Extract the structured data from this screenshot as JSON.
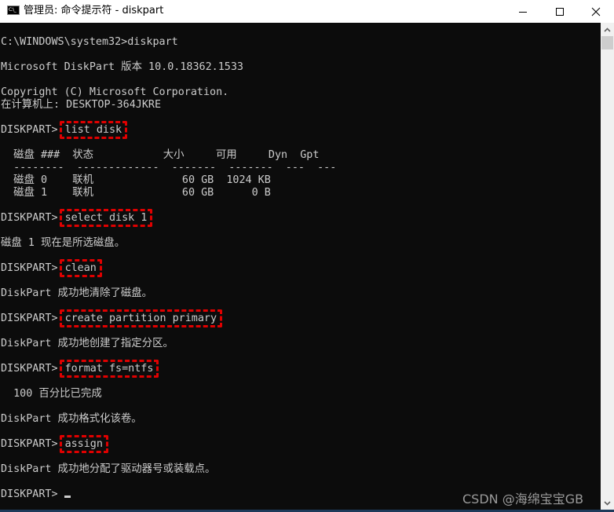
{
  "window": {
    "title": "管理员: 命令提示符 - diskpart",
    "icon_label": "C:\\_",
    "buttons": {
      "minimize": "minimize-icon",
      "maximize": "maximize-icon",
      "close": "close-icon"
    }
  },
  "terminal": {
    "lines": {
      "l1": "C:\\WINDOWS\\system32>diskpart",
      "l2": "Microsoft DiskPart 版本 10.0.18362.1533",
      "l3": "Copyright (C) Microsoft Corporation.",
      "l4": "在计算机上: DESKTOP-364JKRE",
      "prompt": "DISKPART>",
      "cmd_list_disk": "list disk",
      "table_header": "  磁盘 ###  状态           大小     可用     Dyn  Gpt",
      "table_sep": "  --------  -------------  -------  -------  ---  ---",
      "table_row0": "  磁盘 0    联机              60 GB  1024 KB",
      "table_row1": "  磁盘 1    联机              60 GB      0 B",
      "cmd_select": "select disk 1",
      "out_select": "磁盘 1 现在是所选磁盘。",
      "cmd_clean": "clean",
      "out_clean": "DiskPart 成功地清除了磁盘。",
      "cmd_create": "create partition primary",
      "out_create": "DiskPart 成功地创建了指定分区。",
      "cmd_format": "format fs=ntfs",
      "out_progress": "  100 百分比已完成",
      "out_format": "DiskPart 成功格式化该卷。",
      "cmd_assign": "assign",
      "out_assign": "DiskPart 成功地分配了驱动器号或装载点。"
    },
    "disk_table": {
      "columns": [
        "磁盘 ###",
        "状态",
        "大小",
        "可用",
        "Dyn",
        "Gpt"
      ],
      "rows": [
        [
          "磁盘 0",
          "联机",
          "60 GB",
          "1024 KB",
          "",
          ""
        ],
        [
          "磁盘 1",
          "联机",
          "60 GB",
          "0 B",
          "",
          ""
        ]
      ]
    },
    "highlight_color": "#e00000"
  },
  "watermark": "CSDN @海绵宝宝GB"
}
